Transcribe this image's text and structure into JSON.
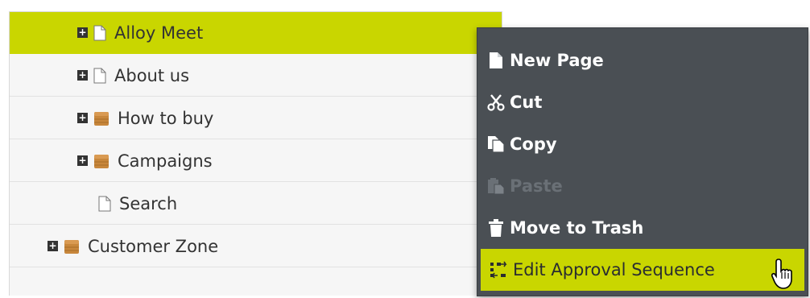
{
  "tree": {
    "items": [
      {
        "label": "Alloy Meet",
        "icon": "page-icon",
        "expandable": true,
        "selected": true
      },
      {
        "label": "About us",
        "icon": "page-icon",
        "expandable": true
      },
      {
        "label": "How to buy",
        "icon": "container-icon",
        "expandable": true
      },
      {
        "label": "Campaigns",
        "icon": "container-icon",
        "expandable": true
      },
      {
        "label": "Search",
        "icon": "page-icon",
        "expandable": false
      },
      {
        "label": "Customer Zone",
        "icon": "container-icon",
        "expandable": true
      }
    ],
    "expander_symbol": "+"
  },
  "context_menu": {
    "items": [
      {
        "label": "New Page",
        "icon": "new-page-icon"
      },
      {
        "label": "Cut",
        "icon": "scissors-icon"
      },
      {
        "label": "Copy",
        "icon": "copy-icon"
      },
      {
        "label": "Paste",
        "icon": "paste-icon",
        "disabled": true
      },
      {
        "label": "Move to Trash",
        "icon": "trash-icon"
      },
      {
        "label": "Edit Approval Sequence",
        "icon": "approval-sequence-icon",
        "highlighted": true
      }
    ]
  },
  "colors": {
    "accent": "#c9d600",
    "menu_bg": "#4a4f54",
    "tree_bg": "#f6f6f6",
    "container_icon": "#c8873c"
  }
}
